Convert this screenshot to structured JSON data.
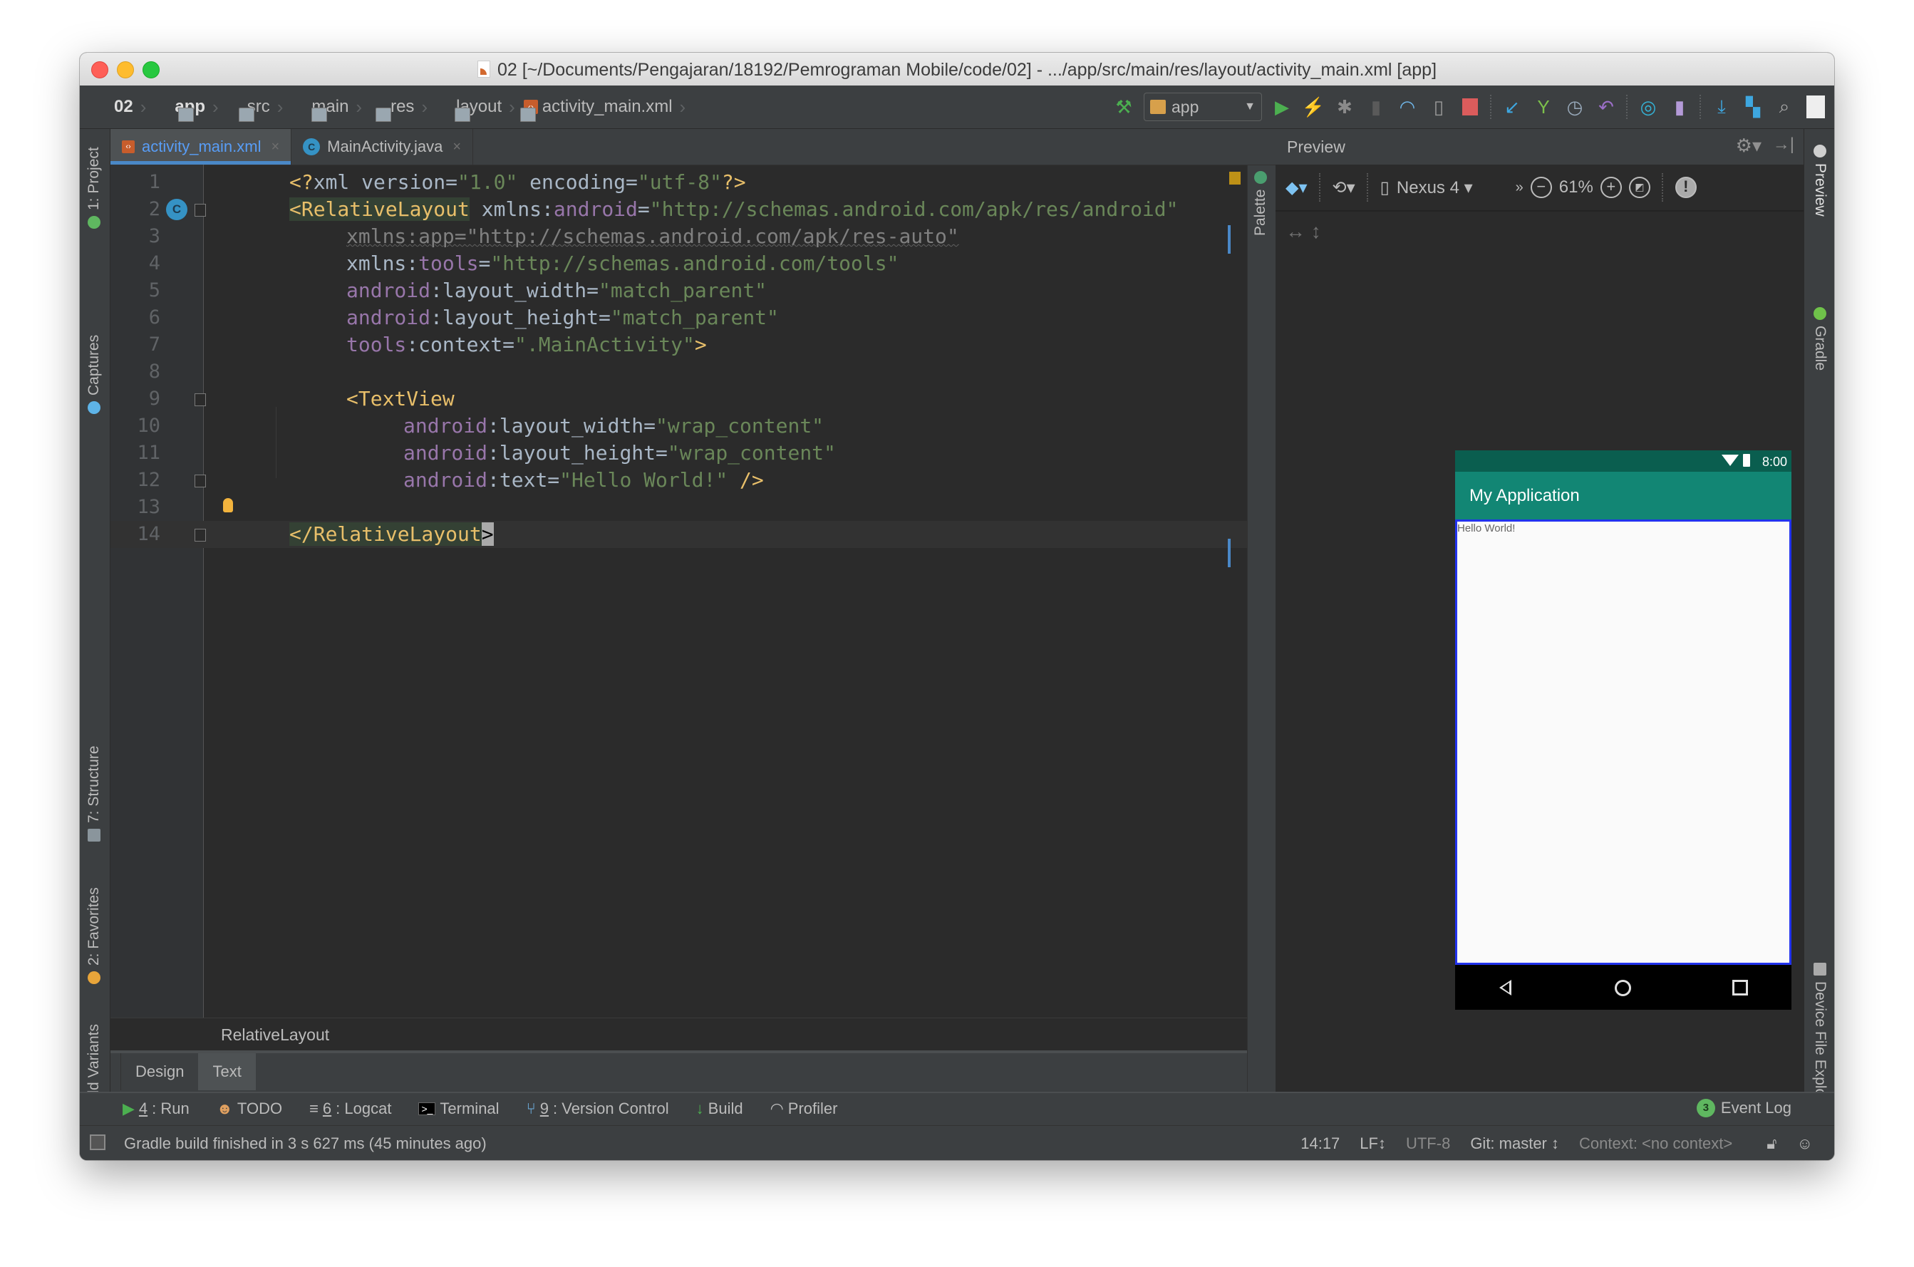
{
  "window": {
    "title": "02 [~/Documents/Pengajaran/18192/Pemrograman Mobile/code/02] - .../app/src/main/res/layout/activity_main.xml [app]"
  },
  "breadcrumbs": [
    {
      "label": "02",
      "icon": "project-folder-icon"
    },
    {
      "label": "app",
      "icon": "module-folder-icon"
    },
    {
      "label": "src",
      "icon": "folder-icon"
    },
    {
      "label": "main",
      "icon": "folder-icon"
    },
    {
      "label": "res",
      "icon": "resource-folder-icon"
    },
    {
      "label": "layout",
      "icon": "folder-icon"
    },
    {
      "label": "activity_main.xml",
      "icon": "xml-file-icon"
    }
  ],
  "toolbar": {
    "run_config": "app",
    "buttons": [
      "make-project-icon",
      "run-icon",
      "apply-changes-icon",
      "debug-icon",
      "attach-debugger-icon",
      "profile-icon",
      "device-debug-icon",
      "stop-icon",
      "vcs-update-icon",
      "vcs-commit-icon",
      "vcs-history-icon",
      "vcs-revert-icon",
      "sync-gradle-icon",
      "avd-manager-icon",
      "sdk-manager-icon",
      "project-structure-icon",
      "search-icon",
      "user-icon"
    ]
  },
  "editor": {
    "tabs": [
      {
        "label": "activity_main.xml",
        "active": true,
        "icon": "xml-file-icon"
      },
      {
        "label": "MainActivity.java",
        "active": false,
        "icon": "java-class-icon"
      }
    ],
    "line_numbers": [
      "1",
      "2",
      "3",
      "4",
      "5",
      "6",
      "7",
      "8",
      "9",
      "10",
      "11",
      "12",
      "13",
      "14"
    ],
    "code": {
      "l1": {
        "a": "<?",
        "b": "xml version=",
        "c": "\"1.0\"",
        "d": " encoding=",
        "e": "\"utf-8\"",
        "f": "?>"
      },
      "l2": {
        "tag": "<RelativeLayout",
        "attr": " xmlns:",
        "ns": "android",
        "eq": "=",
        "val": "\"http://schemas.android.com/apk/res/android\""
      },
      "l3": {
        "text": "xmlns:app=\"http://schemas.android.com/apk/res-auto\""
      },
      "l4": {
        "attr": "xmlns:",
        "ns": "tools",
        "eq": "=",
        "val": "\"http://schemas.android.com/tools\""
      },
      "l5": {
        "ns": "android",
        "attr": ":layout_width=",
        "val": "\"match_parent\""
      },
      "l6": {
        "ns": "android",
        "attr": ":layout_height=",
        "val": "\"match_parent\""
      },
      "l7": {
        "ns": "tools",
        "attr": ":context=",
        "val": "\".MainActivity\"",
        "end": ">"
      },
      "l9": {
        "tag": "<TextView"
      },
      "l10": {
        "ns": "android",
        "attr": ":layout_width=",
        "val": "\"wrap_content\""
      },
      "l11": {
        "ns": "android",
        "attr": ":layout_height=",
        "val": "\"wrap_content\""
      },
      "l12": {
        "ns": "android",
        "attr": ":text=",
        "val": "\"Hello World!\"",
        "end": " />"
      },
      "l14": {
        "tag": "</RelativeLayout",
        "end": ">"
      }
    },
    "breadcrumb_path": "RelativeLayout",
    "bottom_tabs": [
      {
        "label": "Design",
        "active": false
      },
      {
        "label": "Text",
        "active": true
      }
    ]
  },
  "left_tool_windows": [
    {
      "label": "1: Project"
    },
    {
      "label": "Captures"
    },
    {
      "label": "7: Structure"
    },
    {
      "label": "2: Favorites"
    },
    {
      "label": "Build Variants"
    }
  ],
  "right_tool_windows": [
    {
      "label": "Preview"
    },
    {
      "label": "Gradle"
    },
    {
      "label": "Device File Explorer"
    }
  ],
  "palette_label": "Palette",
  "preview": {
    "title": "Preview",
    "device": "Nexus 4",
    "zoom": "61%",
    "phone": {
      "time": "8:00",
      "app_title": "My Application",
      "text": "Hello World!",
      "colors": {
        "status": "#0a5e4f",
        "appbar": "#128674",
        "selection": "#2233ee"
      }
    }
  },
  "bottom_tools": [
    {
      "key": "4",
      "label": ": Run",
      "icon": "run-icon"
    },
    {
      "key": "",
      "label": "TODO",
      "icon": "todo-icon"
    },
    {
      "key": "6",
      "label": ": Logcat",
      "icon": "logcat-icon"
    },
    {
      "key": "",
      "label": "Terminal",
      "icon": "terminal-icon"
    },
    {
      "key": "9",
      "label": ": Version Control",
      "icon": "version-control-icon"
    },
    {
      "key": "",
      "label": "Build",
      "icon": "build-icon"
    },
    {
      "key": "",
      "label": "Profiler",
      "icon": "profiler-icon"
    }
  ],
  "event_log": {
    "label": "Event Log",
    "count": "3"
  },
  "status_bar": {
    "message": "Gradle build finished in 3 s 627 ms (45 minutes ago)",
    "position": "14:17",
    "line_sep": "LF↕",
    "encoding": "UTF-8",
    "git": "Git: master ↕",
    "context": "Context: <no context>"
  }
}
